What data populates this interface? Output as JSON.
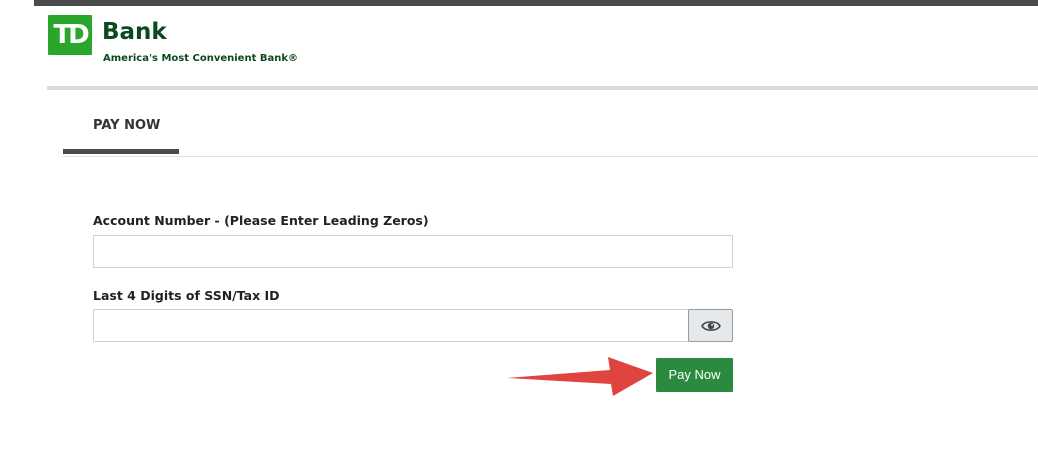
{
  "header": {
    "logo_text": "TD",
    "bank_name": "Bank",
    "tagline": "America's Most Convenient Bank®"
  },
  "tabs": [
    {
      "label": "PAY NOW",
      "active": true
    }
  ],
  "form": {
    "account_number": {
      "label": "Account Number - (Please Enter Leading Zeros)",
      "value": "",
      "placeholder": ""
    },
    "ssn": {
      "label": "Last 4 Digits of SSN/Tax ID",
      "value": "",
      "placeholder": ""
    },
    "toggle_visibility_icon": "eye-icon",
    "submit_label": "Pay Now"
  },
  "annotation": {
    "arrow_color": "#e0443f"
  },
  "colors": {
    "brand_green": "#2aa62a",
    "dark_green_text": "#0b4a1e",
    "button_green": "#2b8a3e"
  }
}
